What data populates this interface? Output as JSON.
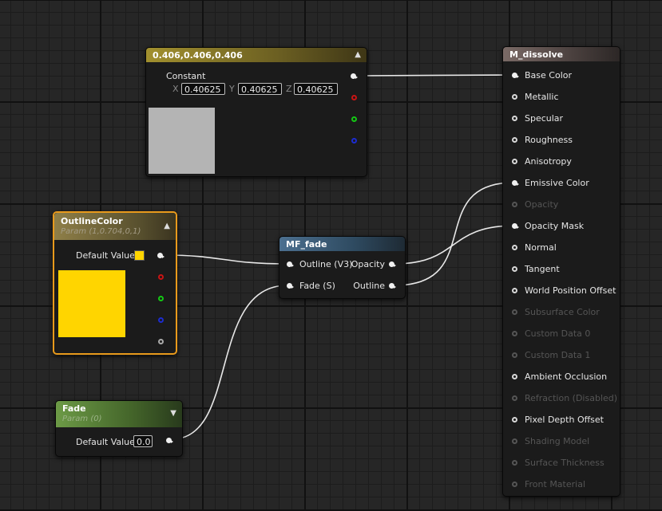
{
  "constant_node": {
    "title": "0.406,0.406,0.406",
    "label": "Constant",
    "axes": [
      "X",
      "Y",
      "Z"
    ],
    "values": [
      "0.40625",
      "0.40625",
      "0.40625"
    ],
    "swatch_color": "#b4b4b4",
    "header_color": "#8a7a2a"
  },
  "outline_node": {
    "title": "OutlineColor",
    "subtitle": "Param (1,0.704,0,1)",
    "default_label": "Default Value",
    "swatch_color": "#ffd500",
    "selection_color": "#f0a020"
  },
  "fade_fn_node": {
    "title": "MF_fade",
    "inputs": [
      "Outline (V3)",
      "Fade (S)"
    ],
    "outputs": [
      "Opacity",
      "Outline"
    ]
  },
  "fade_param_node": {
    "title": "Fade",
    "subtitle": "Param (0)",
    "default_label": "Default Value",
    "default_value": "0.0"
  },
  "material_node": {
    "title": "M_dissolve",
    "inputs": [
      {
        "label": "Base Color",
        "enabled": true,
        "connected": true
      },
      {
        "label": "Metallic",
        "enabled": true,
        "connected": false
      },
      {
        "label": "Specular",
        "enabled": true,
        "connected": false
      },
      {
        "label": "Roughness",
        "enabled": true,
        "connected": false
      },
      {
        "label": "Anisotropy",
        "enabled": true,
        "connected": false
      },
      {
        "label": "Emissive Color",
        "enabled": true,
        "connected": true
      },
      {
        "label": "Opacity",
        "enabled": false,
        "connected": false
      },
      {
        "label": "Opacity Mask",
        "enabled": true,
        "connected": true
      },
      {
        "label": "Normal",
        "enabled": true,
        "connected": false
      },
      {
        "label": "Tangent",
        "enabled": true,
        "connected": false
      },
      {
        "label": "World Position Offset",
        "enabled": true,
        "connected": false
      },
      {
        "label": "Subsurface Color",
        "enabled": false,
        "connected": false
      },
      {
        "label": "Custom Data 0",
        "enabled": false,
        "connected": false
      },
      {
        "label": "Custom Data 1",
        "enabled": false,
        "connected": false
      },
      {
        "label": "Ambient Occlusion",
        "enabled": true,
        "connected": false
      },
      {
        "label": "Refraction (Disabled)",
        "enabled": false,
        "connected": false
      },
      {
        "label": "Pixel Depth Offset",
        "enabled": true,
        "connected": false
      },
      {
        "label": "Shading Model",
        "enabled": false,
        "connected": false
      },
      {
        "label": "Surface Thickness",
        "enabled": false,
        "connected": false
      },
      {
        "label": "Front Material",
        "enabled": false,
        "connected": false
      }
    ]
  }
}
